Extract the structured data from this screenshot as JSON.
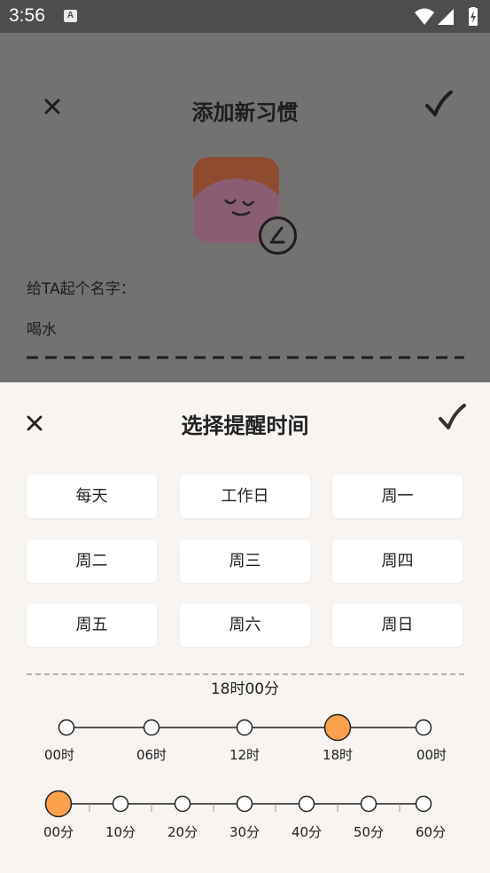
{
  "status_bar": {
    "time": "3:56",
    "notification_icon": "A",
    "icons": [
      "wifi-icon",
      "signal-icon",
      "battery-charging-icon"
    ]
  },
  "background_page": {
    "title": "添加新习惯",
    "name_label": "给TA起个名字：",
    "name_value": "喝水"
  },
  "sheet": {
    "title": "选择提醒时间",
    "days": [
      {
        "label": "每天"
      },
      {
        "label": "工作日"
      },
      {
        "label": "周一"
      },
      {
        "label": "周二"
      },
      {
        "label": "周三"
      },
      {
        "label": "周四"
      },
      {
        "label": "周五"
      },
      {
        "label": "周六"
      },
      {
        "label": "周日"
      }
    ],
    "selected_time": "18时00分",
    "hour_slider": {
      "labels": [
        "00时",
        "06时",
        "12时",
        "18时",
        "00时"
      ],
      "selected_index": 3
    },
    "minute_slider": {
      "labels": [
        "00分",
        "10分",
        "20分",
        "30分",
        "40分",
        "50分",
        "60分"
      ],
      "selected_index": 0
    },
    "accent_color": "#fba04c"
  }
}
